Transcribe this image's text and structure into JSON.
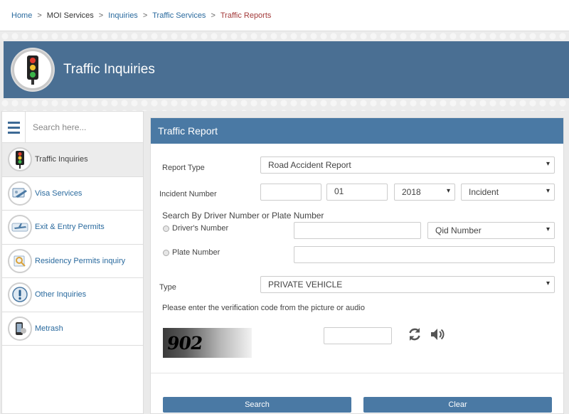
{
  "breadcrumb": {
    "items": [
      {
        "label": "Home",
        "link": true
      },
      {
        "label": "MOI Services",
        "link": false
      },
      {
        "label": "Inquiries",
        "link": true
      },
      {
        "label": "Traffic Services",
        "link": true
      },
      {
        "label": "Traffic Reports",
        "current": true
      }
    ],
    "separator": ">"
  },
  "header": {
    "title": "Traffic Inquiries",
    "icon": "traffic-light-icon"
  },
  "sidebar": {
    "search_placeholder": "Search here...",
    "items": [
      {
        "label": "Traffic Inquiries",
        "icon": "traffic-light-icon",
        "active": true
      },
      {
        "label": "Visa Services",
        "icon": "visa-icon"
      },
      {
        "label": "Exit & Entry Permits",
        "icon": "airplane-icon"
      },
      {
        "label": "Residency Permits inquiry",
        "icon": "residency-icon"
      },
      {
        "label": "Other Inquiries",
        "icon": "exclamation-icon"
      },
      {
        "label": "Metrash",
        "icon": "metrash-icon"
      }
    ]
  },
  "form": {
    "title": "Traffic Report",
    "report_type_label": "Report Type",
    "report_type_value": "Road Accident Report",
    "incident_number_label": "Incident Number",
    "incident_number_value": "",
    "incident_day": "01",
    "incident_year": "2018",
    "incident_kind": "Incident",
    "search_by_heading": "Search By Driver Number or Plate Number",
    "drivers_number_label": "Driver's Number",
    "drivers_number_value": "",
    "id_type": "Qid Number",
    "plate_number_label": "Plate Number",
    "plate_number_value": "",
    "type_label": "Type",
    "type_value": "PRIVATE VEHICLE",
    "verification_text": "Please enter the verification code from the picture or audio",
    "captcha_text": "902",
    "captcha_input": "",
    "search_button": "Search",
    "clear_button": "Clear"
  },
  "colors": {
    "header": "#4a6f93",
    "panel_title": "#4a79a4",
    "link": "#2a6a9e",
    "current_crumb": "#a33a3a"
  }
}
